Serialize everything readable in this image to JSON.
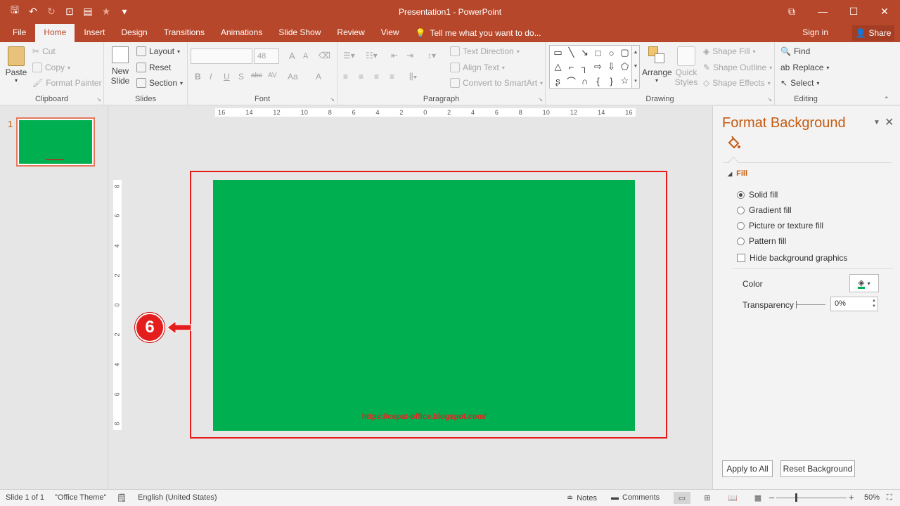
{
  "window": {
    "title": "Presentation1 - PowerPoint",
    "controls": [
      "⧉",
      "—",
      "☐",
      "✕"
    ]
  },
  "qat": {
    "save": "🖫",
    "undo": "↶",
    "redo": "↻",
    "customize": "▾"
  },
  "tabs": {
    "file": "File",
    "home": "Home",
    "insert": "Insert",
    "design": "Design",
    "transitions": "Transitions",
    "animations": "Animations",
    "slideshow": "Slide Show",
    "review": "Review",
    "view": "View",
    "tellme": "Tell me what you want to do..."
  },
  "account": {
    "signin": "Sign in",
    "share": "Share"
  },
  "ribbon": {
    "clipboard": {
      "label": "Clipboard",
      "paste": "Paste",
      "cut": "Cut",
      "copy": "Copy",
      "format_painter": "Format Painter"
    },
    "slides": {
      "label": "Slides",
      "new_slide_1": "New",
      "new_slide_2": "Slide",
      "layout": "Layout",
      "reset": "Reset",
      "section": "Section"
    },
    "font": {
      "label": "Font",
      "font_name": "",
      "font_size": "48",
      "bold": "B",
      "italic": "I",
      "underline": "U",
      "shadow": "S",
      "strike": "abc",
      "spacing": "AV",
      "case": "Aa",
      "color": "A",
      "grow": "A",
      "shrink": "A"
    },
    "paragraph": {
      "label": "Paragraph",
      "text_direction": "Text Direction",
      "align_text": "Align Text",
      "convert_smartart": "Convert to SmartArt"
    },
    "drawing": {
      "label": "Drawing",
      "arrange": "Arrange",
      "quick_styles_1": "Quick",
      "quick_styles_2": "Styles",
      "shape_fill": "Shape Fill",
      "shape_outline": "Shape Outline",
      "shape_effects": "Shape Effects"
    },
    "editing": {
      "label": "Editing",
      "find": "Find",
      "replace": "Replace",
      "select": "Select"
    }
  },
  "thumbnails": {
    "slide_number": "1"
  },
  "rulers": {
    "horizontal": [
      "16",
      "14",
      "12",
      "10",
      "8",
      "6",
      "4",
      "2",
      "0",
      "2",
      "4",
      "6",
      "8",
      "10",
      "12",
      "14",
      "16"
    ],
    "vertical": [
      "8",
      "6",
      "4",
      "2",
      "0",
      "2",
      "4",
      "6",
      "8"
    ]
  },
  "slide": {
    "url": "https://cepat-office.blogspot.com/",
    "background_color": "#00B050"
  },
  "annotation": {
    "step": "6"
  },
  "format_background": {
    "title": "Format Background",
    "section": "Fill",
    "options": {
      "solid": "Solid fill",
      "gradient": "Gradient fill",
      "picture": "Picture or texture fill",
      "pattern": "Pattern fill"
    },
    "selected_option": "Solid fill",
    "hide_graphics": "Hide background graphics",
    "hide_graphics_checked": false,
    "color_label": "Color",
    "color_value": "#00B050",
    "transparency_label": "Transparency",
    "transparency_value": "0%",
    "apply_all": "Apply to All",
    "reset": "Reset Background"
  },
  "status": {
    "slide_info": "Slide 1 of 1",
    "theme": "\"Office Theme\"",
    "language": "English (United States)",
    "notes": "Notes",
    "comments": "Comments",
    "zoom": "50%",
    "zoom_minus": "–",
    "zoom_plus": "+"
  },
  "colors": {
    "accent": "#B7472A",
    "pane_title": "#C55A11",
    "frame": "#E81B1B"
  }
}
